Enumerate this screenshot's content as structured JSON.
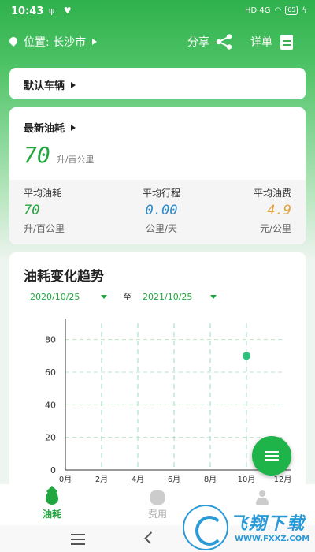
{
  "status_bar": {
    "time": "10:43",
    "left_icons": "ψ ♥",
    "right_icons": "HD 4G",
    "battery": "65"
  },
  "header": {
    "location_label": "位置: 长沙市",
    "share_label": "分享",
    "detail_label": "详单"
  },
  "vehicle_card": {
    "label": "默认车辆"
  },
  "consumption_card": {
    "title": "最新油耗",
    "latest_value": "70",
    "latest_unit": "升/百公里",
    "stats": [
      {
        "title": "平均油耗",
        "value": "70",
        "unit": "升/百公里"
      },
      {
        "title": "平均行程",
        "value": "0.00",
        "unit": "公里/天"
      },
      {
        "title": "平均油费",
        "value": "4.9",
        "unit": "元/公里"
      }
    ]
  },
  "trend": {
    "title": "油耗变化趋势",
    "start_date": "2020/10/25",
    "to_label": "至",
    "end_date": "2021/10/25"
  },
  "chart_data": {
    "type": "scatter",
    "x_ticks": [
      "0月",
      "2月",
      "4月",
      "6月",
      "8月",
      "10月",
      "12月"
    ],
    "y_ticks": [
      "0",
      "20",
      "40",
      "60",
      "80"
    ],
    "xlim": [
      0,
      12
    ],
    "ylim": [
      0,
      90
    ],
    "points": [
      {
        "x": 10,
        "y": 70
      }
    ],
    "x_grid": "dashed",
    "y_grid": "dashed",
    "accent_color": "#2ec27e"
  },
  "bottom_nav": {
    "items": [
      {
        "label": "油耗"
      },
      {
        "label": "费用"
      },
      {
        "label": ""
      }
    ]
  },
  "colors": {
    "brand": "#22a63f",
    "blue": "#2e8ac9",
    "orange": "#e8a23b"
  },
  "watermark": {
    "cn": "飞翔下载",
    "url": "WWW.FXXZ.COM"
  }
}
